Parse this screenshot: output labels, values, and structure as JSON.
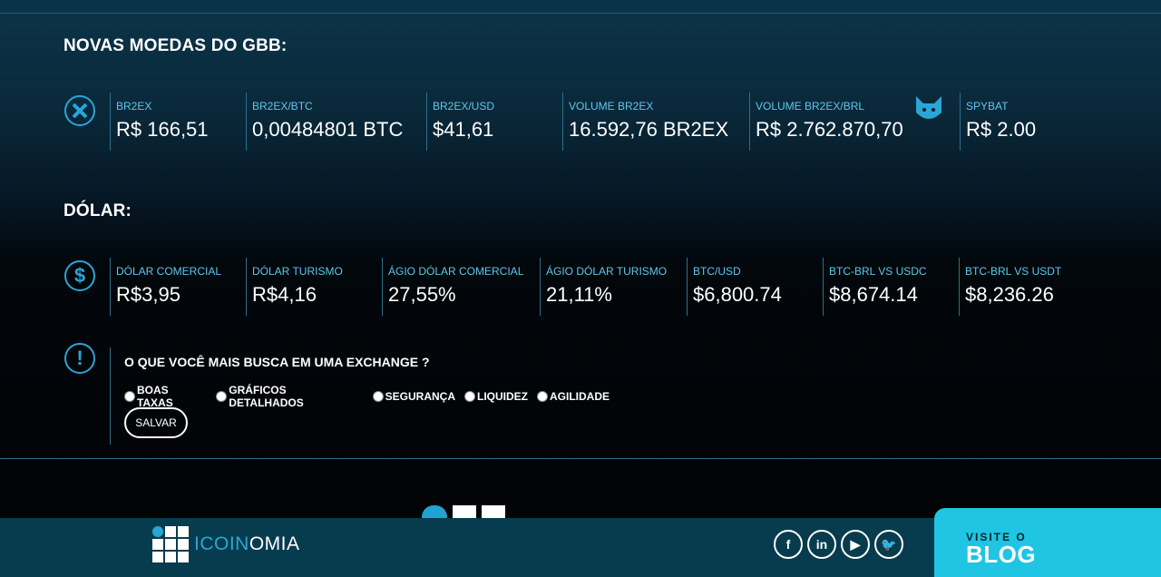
{
  "sections": {
    "new_coins_title": "NOVAS MOEDAS DO GBB:",
    "dollar_title": "DÓLAR:"
  },
  "new_coins": [
    {
      "label": "BR2EX",
      "value": "R$ 166,51"
    },
    {
      "label": "BR2EX/BTC",
      "value": "0,00484801 BTC"
    },
    {
      "label": "BR2EX/USD",
      "value": "$41,61"
    },
    {
      "label": "VOLUME BR2EX",
      "value": "16.592,76 BR2EX"
    },
    {
      "label": "VOLUME BR2EX/BRL",
      "value": "R$ 2.762.870,70"
    },
    {
      "label": "SPYBAT",
      "value": "R$ 2.00"
    }
  ],
  "dollar": [
    {
      "label": "DÓLAR COMERCIAL",
      "value": "R$3,95"
    },
    {
      "label": "DÓLAR TURISMO",
      "value": "R$4,16"
    },
    {
      "label": "ÁGIO DÓLAR COMERCIAL",
      "value": "27,55%"
    },
    {
      "label": "ÁGIO DÓLAR TURISMO",
      "value": "21,11%"
    },
    {
      "label": "BTC/USD",
      "value": "$6,800.74"
    },
    {
      "label": "BTC-BRL VS USDC",
      "value": "$8,674.14"
    },
    {
      "label": "BTC-BRL VS USDT",
      "value": "$8,236.26"
    }
  ],
  "poll": {
    "question": "O QUE VOCÊ MAIS BUSCA EM UMA EXCHANGE ?",
    "options": [
      "BOAS TAXAS",
      "GRÁFICOS DETALHADOS",
      "SEGURANÇA",
      "LIQUIDEZ",
      "AGILIDADE"
    ],
    "save_label": "SALVAR"
  },
  "icons": {
    "br2ex": "br2ex-x-icon",
    "spybat": "bat-icon",
    "dollar": "dollar-icon",
    "poll": "exclamation-icon"
  },
  "footer": {
    "logo_prefix": "ICOIN",
    "logo_suffix": "OMIA",
    "social": [
      "f",
      "in",
      "▶",
      "🐦"
    ],
    "blog_small": "VISITE O",
    "blog_big": "BLOG"
  },
  "colors": {
    "accent": "#29a6d6",
    "blog_bg": "#1fc5e2",
    "footer_bg": "#073c4e"
  }
}
